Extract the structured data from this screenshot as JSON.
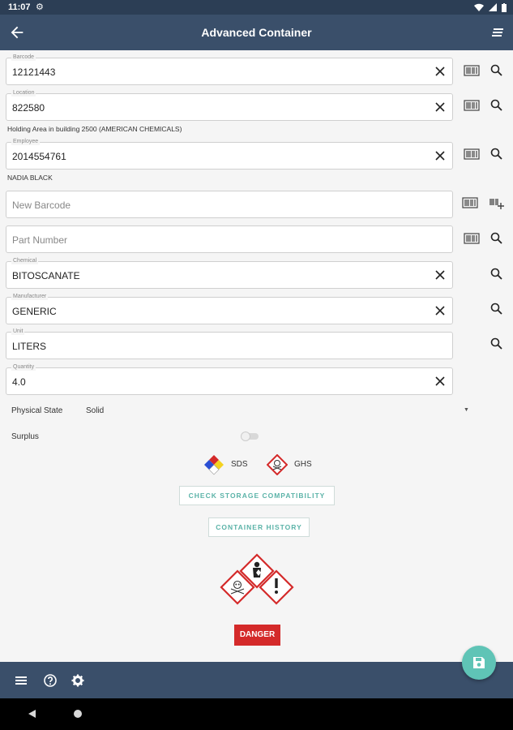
{
  "status_bar": {
    "time": "11:07"
  },
  "app_bar": {
    "title": "Advanced Container"
  },
  "fields": {
    "barcode": {
      "label": "Barcode",
      "value": "12121443"
    },
    "location": {
      "label": "Location",
      "value": "822580",
      "subtext": "Holding Area in building 2500 (AMERICAN CHEMICALS)"
    },
    "employee": {
      "label": "Employee",
      "value": "2014554761",
      "subtext": "NADIA BLACK"
    },
    "new_barcode": {
      "placeholder": "New Barcode"
    },
    "part_number": {
      "placeholder": "Part Number"
    },
    "chemical": {
      "label": "Chemical",
      "value": "BITOSCANATE"
    },
    "manufacturer": {
      "label": "Manufacturer",
      "value": "GENERIC"
    },
    "unit": {
      "label": "Unit",
      "value": "LITERS"
    },
    "quantity": {
      "label": "Quantity",
      "value": "4.0"
    }
  },
  "physical_state": {
    "label": "Physical State",
    "value": "Solid"
  },
  "surplus": {
    "label": "Surplus",
    "on": false
  },
  "links": {
    "sds": "SDS",
    "ghs": "GHS"
  },
  "buttons": {
    "check_storage": "CHECK STORAGE COMPATIBILITY",
    "container_history": "CONTAINER HISTORY"
  },
  "hazard": {
    "signal_word": "DANGER",
    "pictograms": [
      "skull-crossbones",
      "health-hazard",
      "exclamation-mark"
    ]
  },
  "colors": {
    "app_bar": "#3a4f6a",
    "status_bar": "#2c3e55",
    "accent": "#5fc4b6",
    "danger": "#d42a2a"
  }
}
